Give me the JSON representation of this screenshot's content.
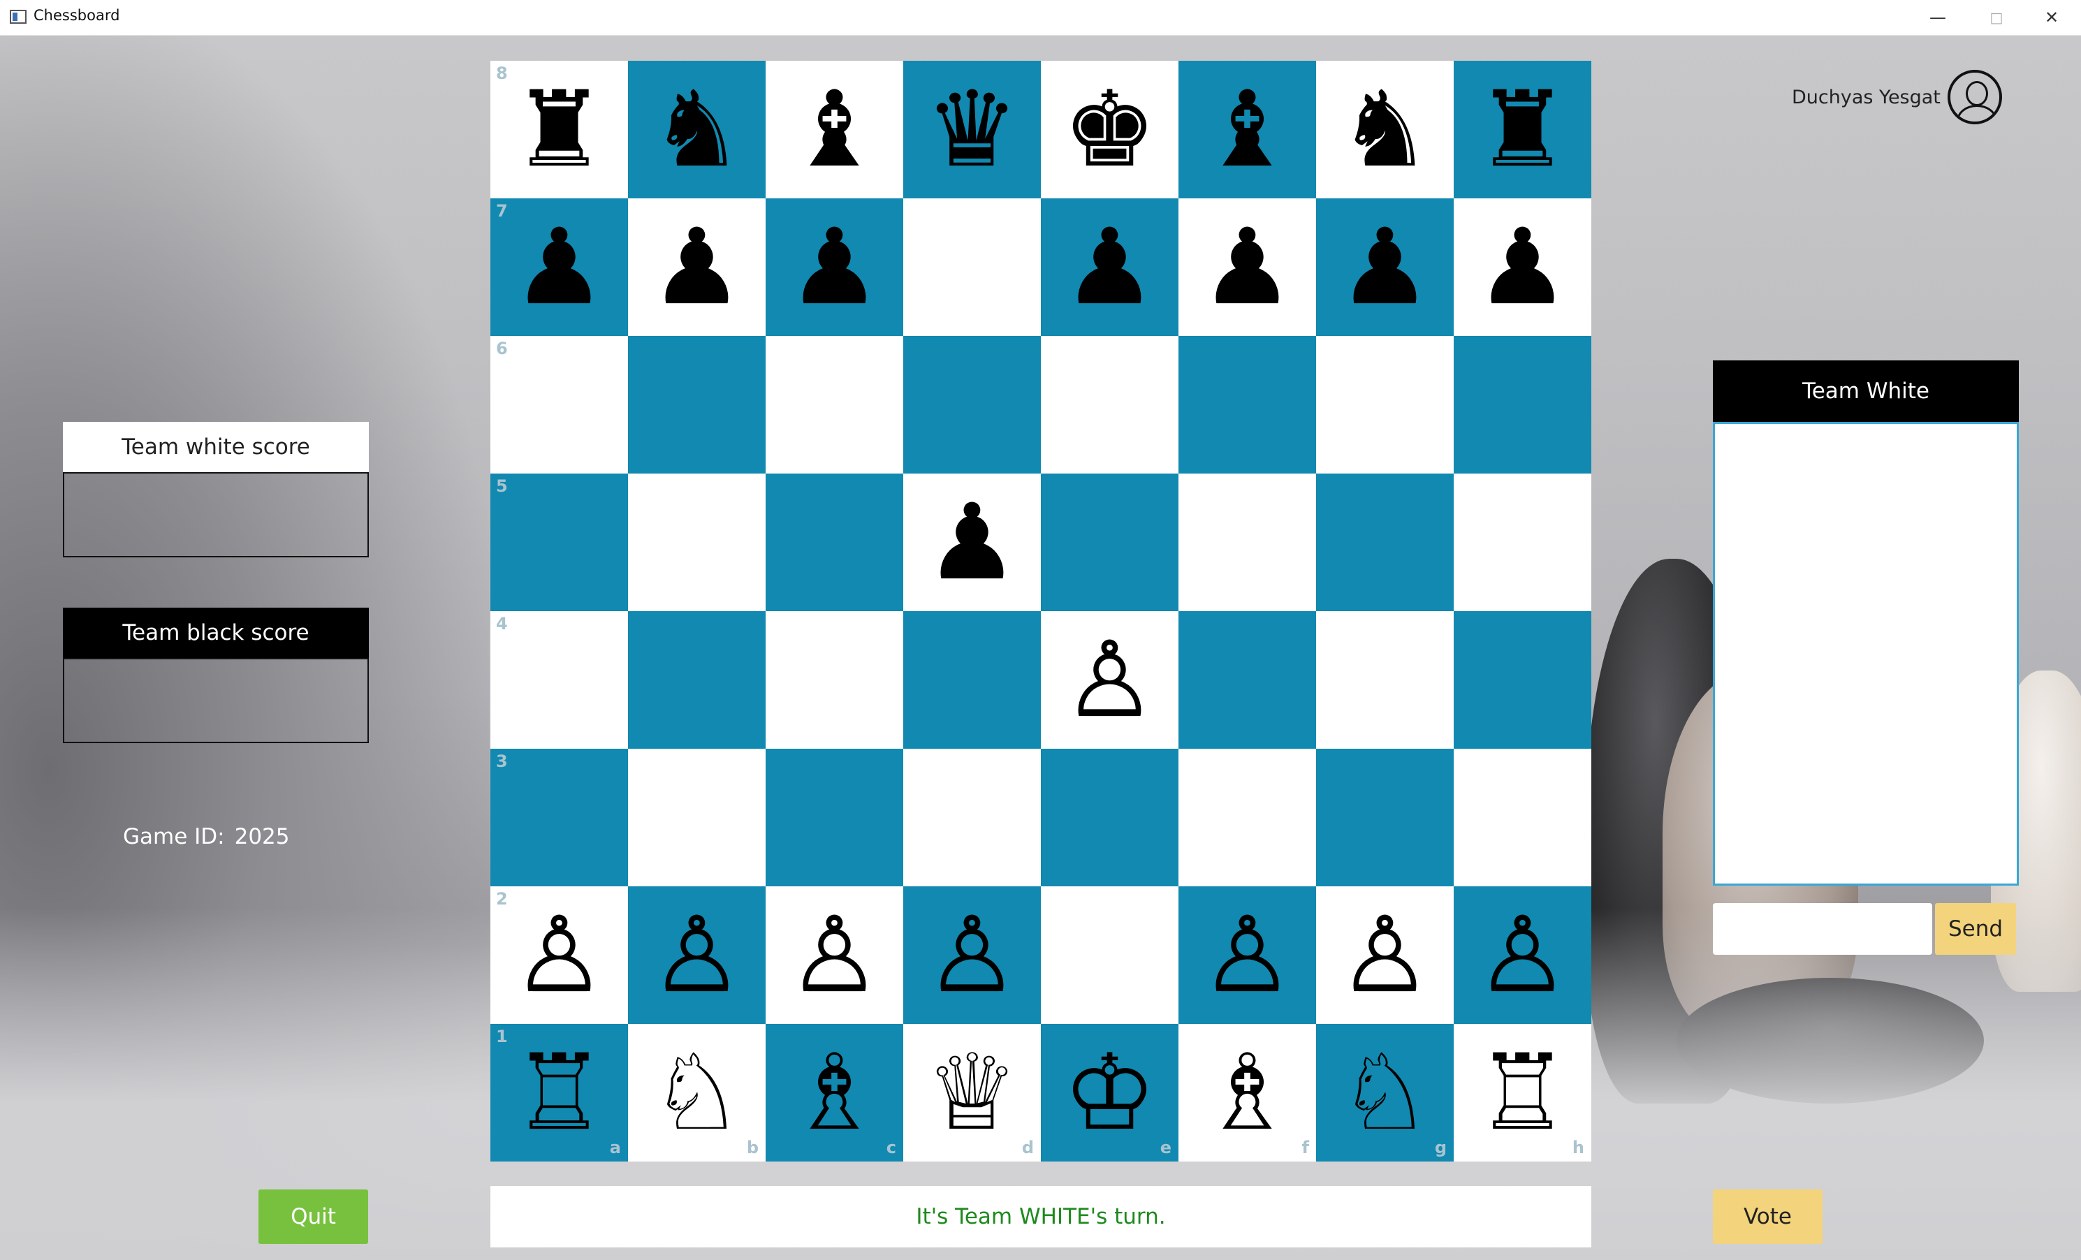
{
  "window": {
    "title": "Chessboard",
    "minimize_icon": "minimize-icon",
    "maximize_icon": "maximize-icon",
    "close_icon": "close-icon"
  },
  "user": {
    "name": "Duchyas Yesgat",
    "avatar_icon": "user-avatar-icon"
  },
  "scores": {
    "white_label": "Team white score",
    "black_label": "Team black score",
    "white_value": "",
    "black_value": ""
  },
  "game": {
    "id_label": "Game ID:",
    "id_value": "2025"
  },
  "board": {
    "colors": {
      "light": "#ffffff",
      "dark": "#1189b1"
    },
    "ranks": [
      "8",
      "7",
      "6",
      "5",
      "4",
      "3",
      "2",
      "1"
    ],
    "files": [
      "a",
      "b",
      "c",
      "d",
      "e",
      "f",
      "g",
      "h"
    ],
    "position": [
      [
        "♜",
        "♞",
        "♝",
        "♛",
        "♚",
        "♝",
        "♞",
        "♜"
      ],
      [
        "♟",
        "♟",
        "♟",
        "",
        "♟",
        "♟",
        "♟",
        "♟"
      ],
      [
        "",
        "",
        "",
        "",
        "",
        "",
        "",
        ""
      ],
      [
        "",
        "",
        "",
        "♟",
        "",
        "",
        "",
        ""
      ],
      [
        "",
        "",
        "",
        "",
        "♙",
        "",
        "",
        ""
      ],
      [
        "",
        "",
        "",
        "",
        "",
        "",
        "",
        ""
      ],
      [
        "♙",
        "♙",
        "♙",
        "♙",
        "",
        "♙",
        "♙",
        "♙"
      ],
      [
        "♖",
        "♘",
        "♗",
        "♕",
        "♔",
        "♗",
        "♘",
        "♖"
      ]
    ]
  },
  "status": {
    "text": "It's Team WHITE's turn.",
    "color": "#1e8a1e"
  },
  "chat": {
    "title": "Team White",
    "input_value": "",
    "send_label": "Send"
  },
  "buttons": {
    "quit_label": "Quit",
    "vote_label": "Vote"
  }
}
